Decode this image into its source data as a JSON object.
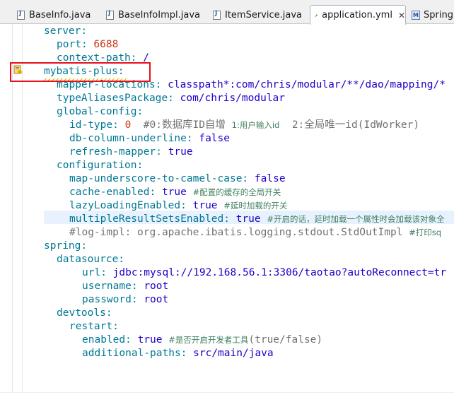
{
  "tabs": [
    {
      "label": "BaseInfo.java",
      "type": "java"
    },
    {
      "label": "BaseInfoImpl.java",
      "type": "java"
    },
    {
      "label": "ItemService.java",
      "type": "java"
    },
    {
      "label": "application.yml",
      "type": "yml",
      "active": true,
      "close": "✕"
    },
    {
      "label": "SpringB",
      "type": "manifest",
      "icon_text": "M"
    }
  ],
  "lines": [
    {
      "key": "server:"
    },
    {
      "key": "port:",
      "value": "6688"
    },
    {
      "key": "context-path:",
      "value": "/"
    },
    {
      "key": "mybatis-plus:"
    },
    {
      "key": "mapper-locations:",
      "value": "classpath*:com/chris/modular/**/dao/mapping/*"
    },
    {
      "key": "typeAliasesPackage:",
      "value": "com/chris/modular"
    },
    {
      "key": "global-config:"
    },
    {
      "key": "id-type:",
      "value": "0",
      "comment_a": "#0:数据库ID自增",
      "comment_b": "1:用户输入id",
      "comment_c": "2:全局唯一id(IdWorker)"
    },
    {
      "key": "db-column-underline:",
      "value": "false"
    },
    {
      "key": "refresh-mapper:",
      "value": "true"
    },
    {
      "key": "configuration:"
    },
    {
      "key": "map-underscore-to-camel-case:",
      "value": "false"
    },
    {
      "key": "cache-enabled:",
      "value": "true",
      "comment": "#配置的缓存的全局开关"
    },
    {
      "key": "lazyLoadingEnabled:",
      "value": "true",
      "comment": "#延时加载的开关"
    },
    {
      "key": "multipleResultSetsEnabled:",
      "value": "true",
      "comment": "#开启的话，延时加载一个属性时会加载该对象全"
    },
    {
      "commented": "#log-impl: org.apache.ibatis.logging.stdout.StdOutImpl",
      "comment": "#打印sq"
    },
    {
      "key": "spring:"
    },
    {
      "key": "datasource:"
    },
    {
      "key": "url:",
      "value": "jdbc:mysql://192.168.56.1:3306/taotao?autoReconnect=tr"
    },
    {
      "key": "username:",
      "value": "root"
    },
    {
      "key": "password:",
      "value": "root"
    },
    {
      "key": "devtools:"
    },
    {
      "key": "restart:"
    },
    {
      "key": "enabled:",
      "value": "true",
      "comment_a": "#是否开启开发者工具",
      "comment_b": "(true/false)"
    },
    {
      "key": "additional-paths:",
      "value": "src/main/java"
    }
  ]
}
